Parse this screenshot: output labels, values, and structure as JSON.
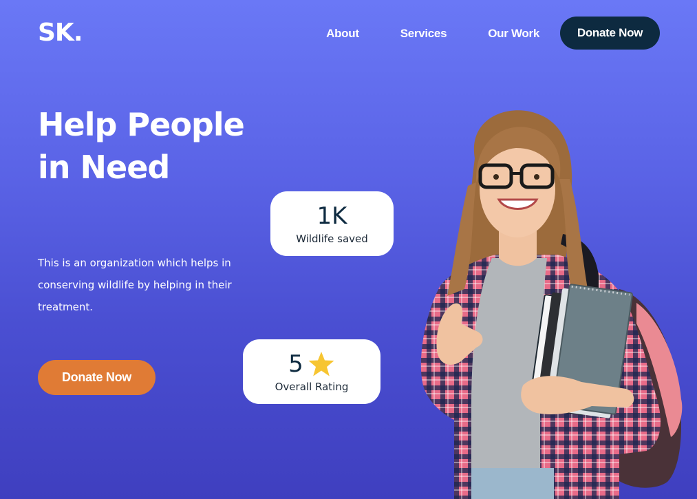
{
  "header": {
    "logo": "SK.",
    "nav": [
      "About",
      "Services",
      "Our Work"
    ],
    "cta": "Donate Now"
  },
  "hero": {
    "headline": "Help People in Need",
    "description": "This is an organization which helps in conserving wildlife by helping in their treatment.",
    "cta": "Donate Now"
  },
  "stats": {
    "wildlife": {
      "value": "1K",
      "label": "Wildlife saved"
    },
    "rating": {
      "value": "5",
      "label": "Overall Rating",
      "icon": "star-icon",
      "star_color": "#f7c531"
    }
  },
  "colors": {
    "nav_button": "#0d2a40",
    "hero_button": "#e07b35",
    "background_top": "#6a78f6",
    "background_bottom": "#3f3fbf"
  }
}
